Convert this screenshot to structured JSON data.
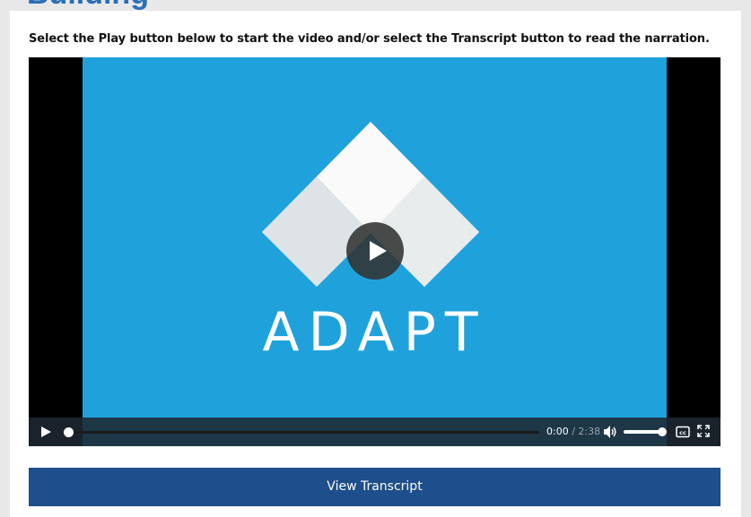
{
  "page": {
    "heading_partial": "Building"
  },
  "instruction": "Select the Play button below to start the video and/or select the Transcript button to read the narration.",
  "video": {
    "poster_logo_text": "ADAPT",
    "current_time": "0:00",
    "separator": "/",
    "duration": "2:38",
    "progress": 0,
    "volume": 1.0,
    "colors": {
      "poster_background": "#1fa2dc",
      "controls_background": "#1e2832"
    },
    "icons": {
      "big_play": "play-circle-icon",
      "play": "play-icon",
      "volume": "volume-icon",
      "captions": "closed-captions-icon",
      "fullscreen": "fullscreen-icon"
    }
  },
  "transcript_button": {
    "label": "View Transcript",
    "color": "#1e4e8c"
  }
}
